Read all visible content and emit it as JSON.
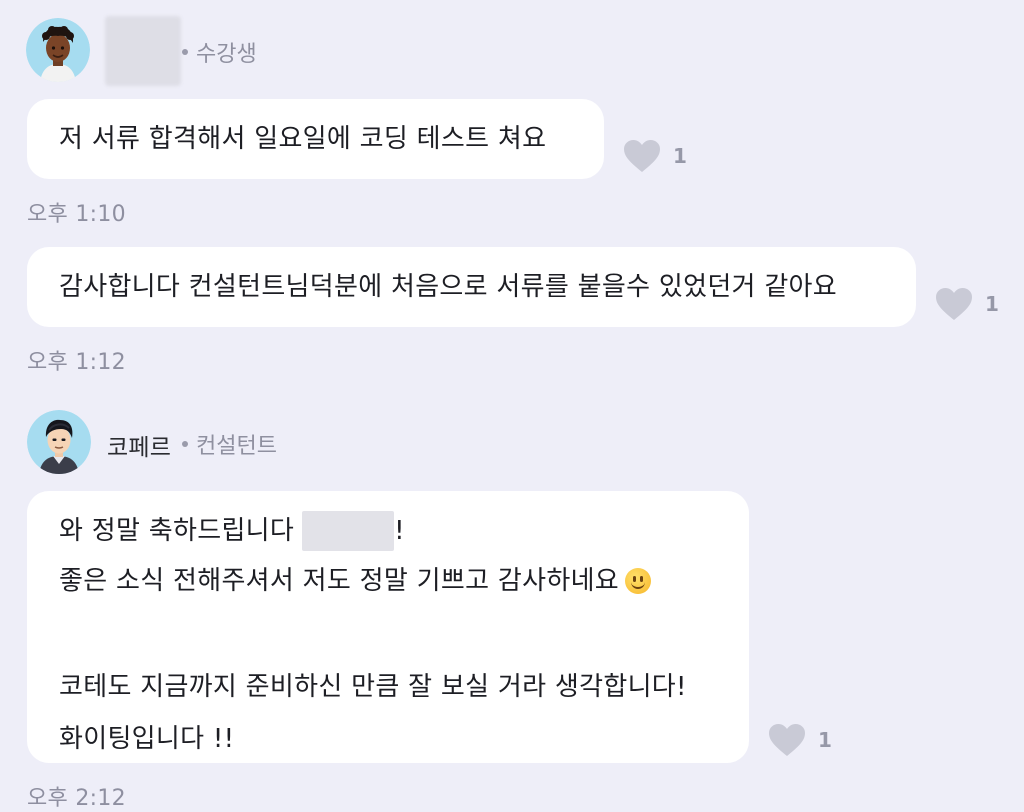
{
  "messages": [
    {
      "sender": {
        "name": "",
        "role": "수강생",
        "avatar": "student-avatar"
      },
      "bubble_lines": [
        "저 서류 합격해서 일요일에 코딩 테스트 쳐요"
      ],
      "reaction": {
        "icon": "heart-icon",
        "count": "1"
      },
      "time": "오후 1:10"
    },
    {
      "bubble_lines": [
        "감사합니다 컨설턴트님덕분에 처음으로 서류를 붙을수 있었던거 같아요"
      ],
      "reaction": {
        "icon": "heart-icon",
        "count": "1"
      },
      "time": "오후 1:12"
    },
    {
      "sender": {
        "name": "코페르",
        "role": "컨설턴트",
        "avatar": "consultant-avatar"
      },
      "bubble_lines": [
        "와 정말 축하드립니다",
        "!",
        "좋은 소식 전해주셔서 저도 정말 기쁘고 감사하네요",
        "",
        "코테도 지금까지 준비하신 만큼 잘 보실 거라 생각합니다!",
        "화이팅입니다 !!"
      ],
      "emoji": "slightly-smiling-face",
      "reaction": {
        "icon": "heart-icon",
        "count": "1"
      },
      "time": "오후 2:12"
    }
  ],
  "colors": {
    "background": "#eeeef8",
    "bubble": "#ffffff",
    "heart": "#c9cad6",
    "meta_text": "#8e8fa0"
  }
}
